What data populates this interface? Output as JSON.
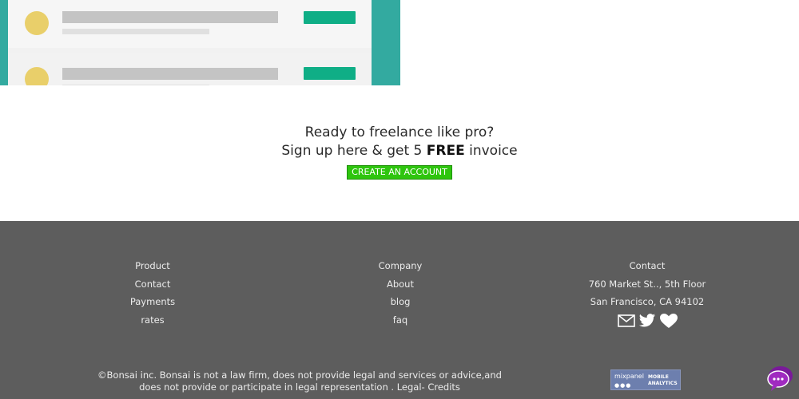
{
  "cta": {
    "line1": "Ready to freelance like pro?",
    "line2_prefix": "Sign up here & get 5 ",
    "line2_bold": "FREE",
    "line2_suffix": " invoice",
    "button_label": "CREATE AN ACCOUNT"
  },
  "footer": {
    "product": {
      "heading": "Product",
      "links": [
        "Contact",
        "Payments",
        "rates"
      ]
    },
    "company": {
      "heading": "Company",
      "links": [
        "About",
        "blog",
        "faq"
      ]
    },
    "contact": {
      "heading": "Contact",
      "address_line1": "760 Market St.., 5th Floor",
      "address_line2": "San Francisco, CA 94102",
      "social_icons": [
        "mail-icon",
        "twitter-icon",
        "heart-icon"
      ]
    },
    "copyright_line1": "©Bonsai inc. Bonsai is not a law firm, does not provide legal and services or advice,and",
    "copyright_line2": "does not provide or participate in legal representation . Legal- Credits",
    "badge": {
      "name": "mixpanel",
      "sub1": "MOBILE",
      "sub2": "ANALYTICS"
    }
  },
  "colors": {
    "illustration_bg": "#33aaa0",
    "cta_button": "#2ec50e",
    "footer_bg": "#5d5d5d",
    "illustration_button": "#0fae86",
    "avatar": "#e9cf6a"
  }
}
